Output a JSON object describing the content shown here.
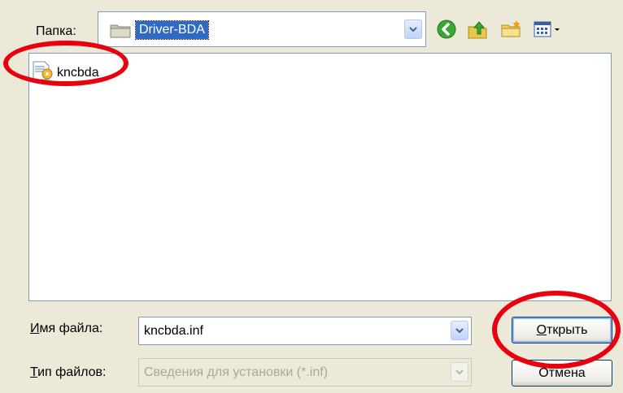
{
  "toolbar": {
    "lookin_label": "Папка:",
    "current_folder": "Driver-BDA",
    "icons": [
      "back-icon",
      "up-folder-icon",
      "new-folder-icon",
      "view-menu-icon"
    ]
  },
  "file_list": {
    "items": [
      {
        "name": "kncbda",
        "icon": "setup-information-file-icon"
      }
    ]
  },
  "filename": {
    "label_mnemonic": "И",
    "label_rest": "мя файла:",
    "value": "kncbda.inf"
  },
  "filetype": {
    "label_mnemonic": "Т",
    "label_rest": "ип файлов:",
    "value": "Сведения для установки (*.inf)"
  },
  "buttons": {
    "open_mnemonic": "О",
    "open_rest": "ткрыть",
    "cancel": "Отмена"
  },
  "colors": {
    "dialog_bg": "#ece9d8",
    "selection": "#316ac5",
    "annotation_red": "#e8000e"
  }
}
